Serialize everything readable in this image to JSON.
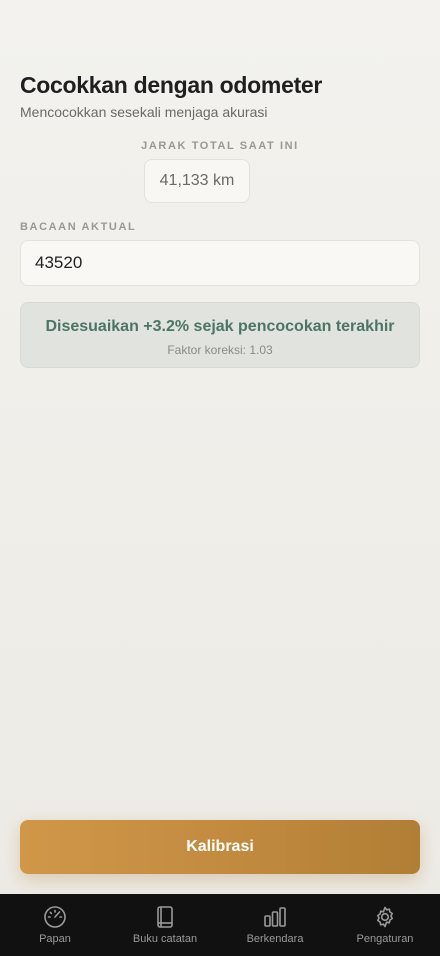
{
  "header": {
    "title": "Cocokkan dengan odometer",
    "subtitle": "Mencocokkan sesekali menjaga akurasi"
  },
  "current_distance": {
    "label": "JARAK TOTAL SAAT INI",
    "value": "41,133 km"
  },
  "actual_reading": {
    "label": "BACAAN AKTUAL",
    "value": "43520"
  },
  "adjustment": {
    "message": "Disesuaikan +3.2% sejak pencocokan terakhir",
    "factor": "Faktor koreksi: 1.03"
  },
  "actions": {
    "calibrate_label": "Kalibrasi"
  },
  "tabbar": {
    "items": [
      {
        "label": "Papan",
        "icon": "dashboard-gauge-icon"
      },
      {
        "label": "Buku catatan",
        "icon": "book-icon"
      },
      {
        "label": "Berkendara",
        "icon": "bar-chart-icon"
      },
      {
        "label": "Pengaturan",
        "icon": "gear-icon"
      }
    ]
  },
  "colors": {
    "accent": "#c18a3f",
    "positive_text": "#4d7565",
    "tabbar_bg": "#111111"
  }
}
